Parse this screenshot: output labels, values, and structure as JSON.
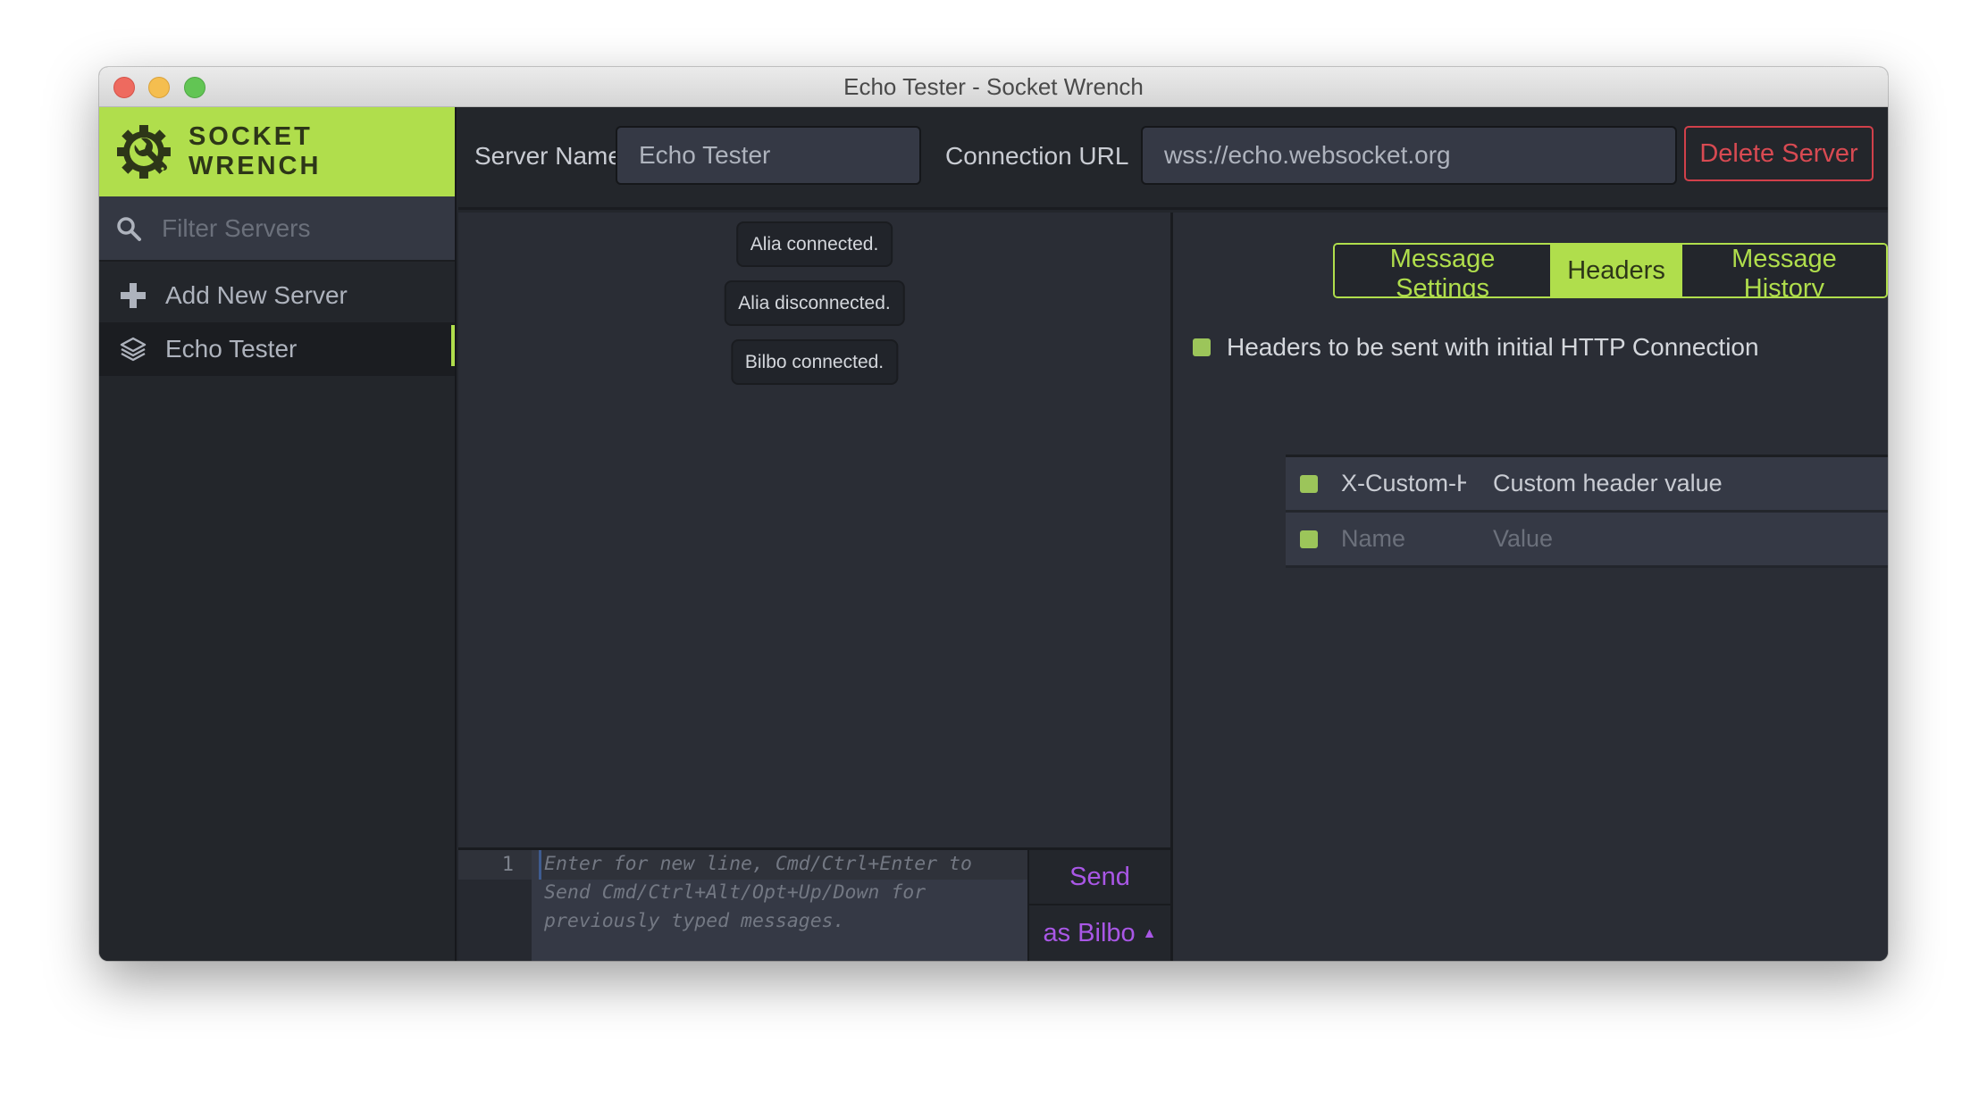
{
  "window": {
    "title": "Echo Tester - Socket Wrench"
  },
  "sidebar": {
    "brand": "SOCKET WRENCH",
    "brand_icon": "gear-wrench-icon",
    "filter_placeholder": "Filter Servers",
    "filter_value": "",
    "items": [
      {
        "label": "Add New Server",
        "icon": "plus-icon",
        "active": false
      },
      {
        "label": "Echo Tester",
        "icon": "layers-icon",
        "active": true
      }
    ]
  },
  "topbar": {
    "server_name_label": "Server Name",
    "server_name_value": "Echo Tester",
    "connection_url_label": "Connection URL",
    "connection_url_value": "wss://echo.websocket.org",
    "delete_label": "Delete Server"
  },
  "messages": [
    {
      "text": "Alia connected."
    },
    {
      "text": "Alia disconnected."
    },
    {
      "text": "Bilbo connected."
    }
  ],
  "composer": {
    "line_number": "1",
    "placeholder": "Enter for new line, Cmd/Ctrl+Enter to Send Cmd/Ctrl+Alt/Opt+Up/Down for previously typed messages.",
    "value": "",
    "send_label": "Send",
    "as_user_label": "as Bilbo",
    "as_user_caret": "▲"
  },
  "right_panel": {
    "tabs": [
      {
        "label": "Message Settings",
        "active": false
      },
      {
        "label": "Headers",
        "active": true
      },
      {
        "label": "Message History",
        "active": false
      }
    ],
    "headers_title": "Headers to be sent with initial HTTP Connection",
    "headers_enabled": true,
    "headers": [
      {
        "enabled": true,
        "name": "X-Custom-Header",
        "value": "Custom header value",
        "name_placeholder": "Name",
        "value_placeholder": "Value"
      },
      {
        "enabled": true,
        "name": "",
        "value": "",
        "name_placeholder": "Name",
        "value_placeholder": "Value"
      }
    ]
  },
  "colors": {
    "accent": "#b0de4c",
    "danger": "#d84a52",
    "send": "#a957e6",
    "background": "#2a2d35",
    "sidebar": "#23262b"
  }
}
